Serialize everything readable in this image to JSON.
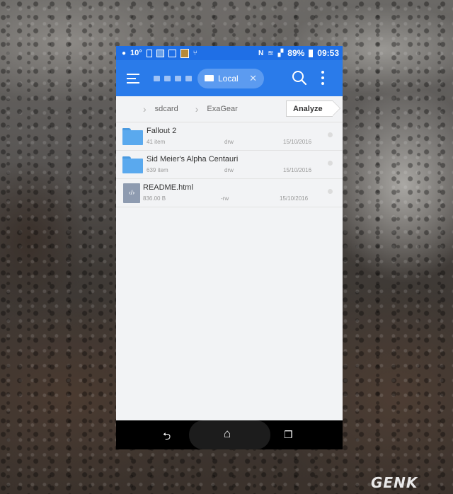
{
  "status_bar": {
    "temperature": "10°",
    "battery": "89%",
    "time": "09:53",
    "icons": [
      "notification-dot-icon",
      "phone-icon",
      "image-icon",
      "box-icon",
      "thumbnail-icon",
      "usb-icon",
      "nfc-icon",
      "wifi-icon",
      "signal-icon",
      "battery-icon"
    ]
  },
  "app_bar": {
    "menu_icon": "hamburger-icon",
    "location_chip_label": "Local",
    "search_icon": "search-icon",
    "more_icon": "more-vert-icon"
  },
  "path_bar": {
    "crumbs": [
      "sdcard",
      "ExaGear"
    ],
    "analyze_label": "Analyze"
  },
  "files": [
    {
      "name": "Fallout 2",
      "detail": "41 item",
      "perm": "drw",
      "date": "15/10/2016",
      "type": "folder"
    },
    {
      "name": "Sid Meier's Alpha Centauri",
      "detail": "639 item",
      "perm": "drw",
      "date": "15/10/2016",
      "type": "folder"
    },
    {
      "name": "README.html",
      "detail": "836.00 B",
      "perm": "-rw",
      "date": "15/10/2016",
      "type": "html",
      "icon_glyph": "‹/›"
    }
  ],
  "nav_bar": {
    "back": "⮌",
    "home": "⌂",
    "recents": "❐"
  },
  "watermark": "GENK",
  "colors": {
    "status_bar": "#1f6fe6",
    "app_bar": "#2a7bea",
    "chip": "#5c9bf0",
    "folder": "#5aa9ee"
  }
}
